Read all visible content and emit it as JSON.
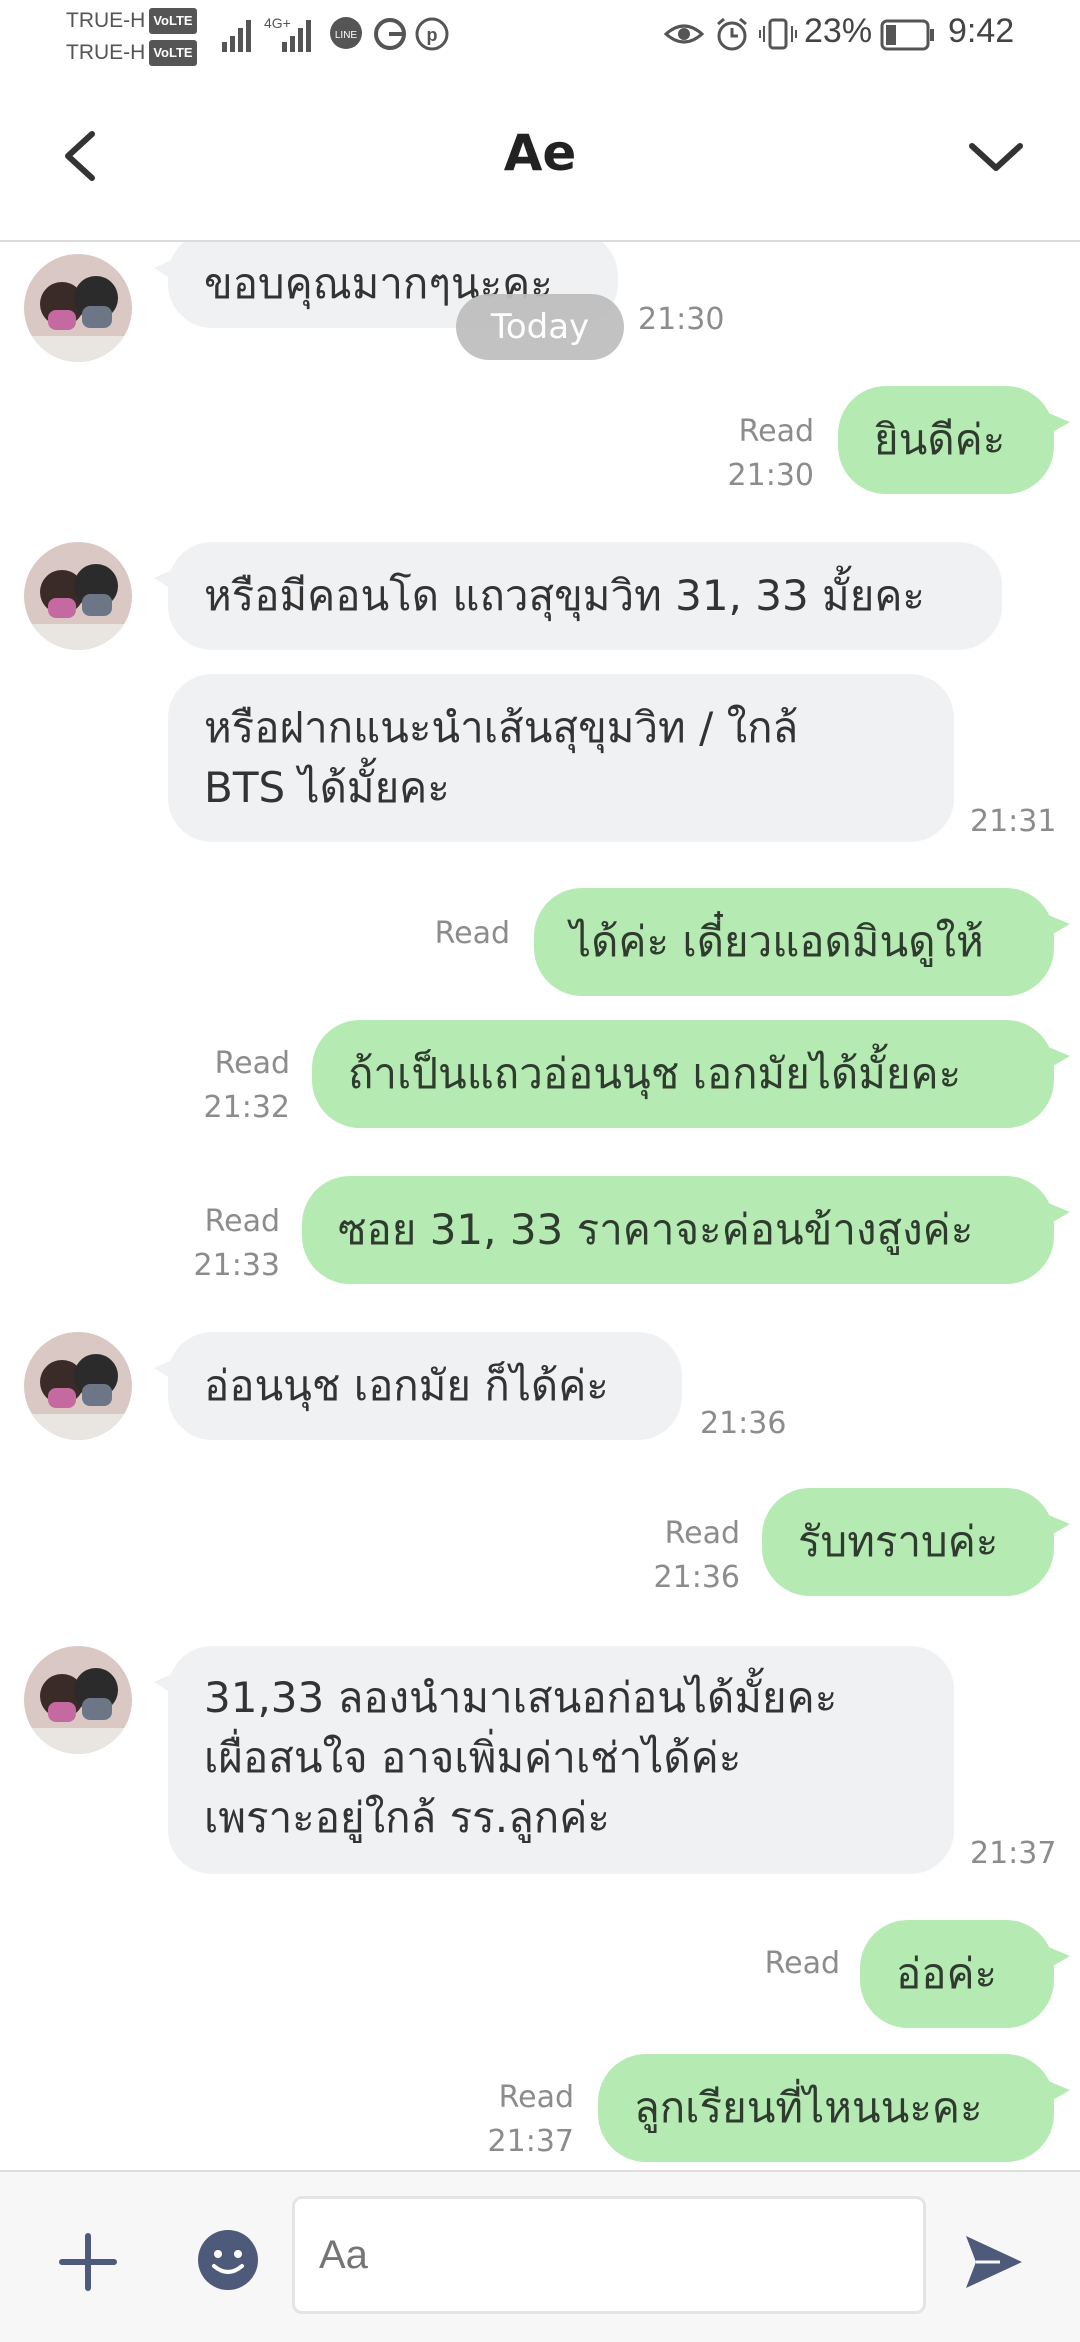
{
  "status_bar": {
    "carrier1": "TRUE-H",
    "carrier2": "TRUE-H",
    "volte": "VoLTE",
    "network": "4G+",
    "battery": "23%",
    "time": "9:42"
  },
  "header": {
    "title": "Ae"
  },
  "chat": {
    "date_divider": "Today",
    "messages": [
      {
        "text": "ขอบคุณมากๆนะคะ",
        "time": "21:30"
      },
      {
        "text": "ยินดีค่ะ",
        "read": "Read",
        "time": "21:30"
      },
      {
        "text": "หรือมีคอนโด แถวสุขุมวิท 31, 33 มั้ยคะ"
      },
      {
        "line1": "หรือฝากแนะนำเส้นสุขุมวิท / ใกล้",
        "line2": "BTS ได้มั้ยคะ",
        "time": "21:31"
      },
      {
        "text": "ได้ค่ะ เดี๋ยวแอดมินดูให้",
        "read": "Read"
      },
      {
        "text": "ถ้าเป็นแถวอ่อนนุช เอกมัยได้มั้ยคะ",
        "read": "Read",
        "time": "21:32"
      },
      {
        "text": "ซอย 31, 33 ราคาจะค่อนข้างสูงค่ะ",
        "read": "Read",
        "time": "21:33"
      },
      {
        "text": "อ่อนนุช เอกมัย ก็ได้ค่ะ",
        "time": "21:36"
      },
      {
        "text": "รับทราบค่ะ",
        "read": "Read",
        "time": "21:36"
      },
      {
        "line1": "31,33 ลองนำมาเสนอก่อนได้มั้ยคะ",
        "line2": "เผื่อสนใจ อาจเพิ่มค่าเช่าได้ค่ะ",
        "line3": "เพราะอยู่ใกล้ รร.ลูกค่ะ",
        "time": "21:37"
      },
      {
        "text": "อ่อค่ะ",
        "read": "Read"
      },
      {
        "text": "ลูกเรียนที่ไหนนะคะ",
        "read": "Read",
        "time": "21:37"
      }
    ]
  },
  "input": {
    "placeholder": "Aa"
  },
  "icons": {
    "back": "chevron-left-icon",
    "menu": "chevron-down-icon",
    "add": "plus-icon",
    "emoji": "emoji-icon",
    "send": "send-icon"
  },
  "colors": {
    "outgoing_bubble": "#b6eab3",
    "incoming_bubble": "#f0f1f3",
    "meta_text": "#8c8c8c",
    "icon_blue": "#4e5a7a"
  }
}
